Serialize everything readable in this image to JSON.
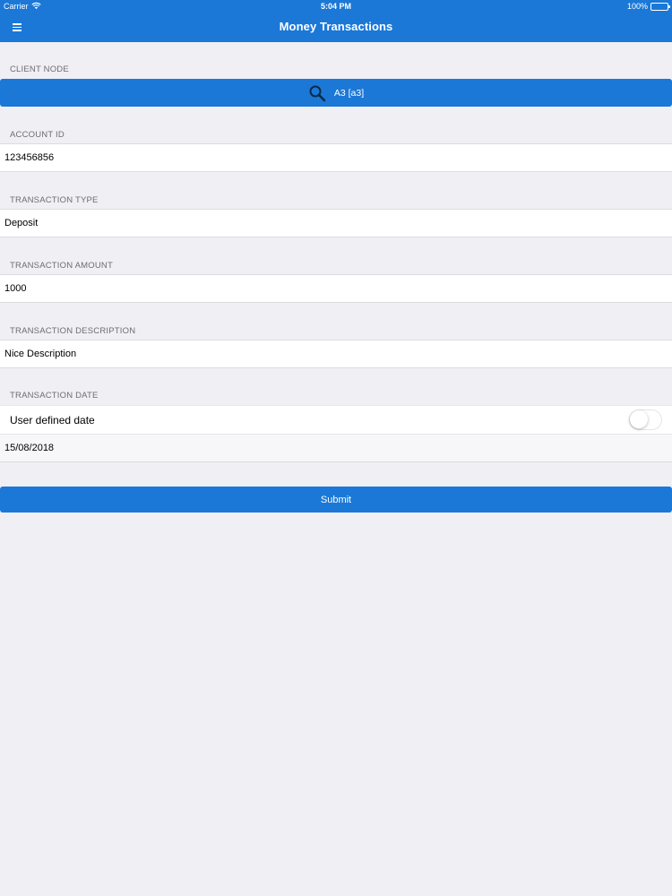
{
  "status_bar": {
    "carrier": "Carrier",
    "time": "5:04 PM",
    "battery": "100%"
  },
  "nav": {
    "title": "Money Transactions",
    "icon_menu": "hamburger-menu-icon"
  },
  "client_node": {
    "label": "CLIENT NODE",
    "button_text": "A3 [a3]",
    "icon": "search-icon"
  },
  "account_id": {
    "label": "ACCOUNT ID",
    "value": "123456856"
  },
  "transaction_type": {
    "label": "TRANSACTION TYPE",
    "value": "Deposit"
  },
  "transaction_amount": {
    "label": "TRANSACTION AMOUNT",
    "value": "1000"
  },
  "transaction_description": {
    "label": "TRANSACTION DESCRIPTION",
    "value": "Nice Description"
  },
  "transaction_date": {
    "label": "TRANSACTION DATE",
    "toggle_label": "User defined date",
    "toggle_on": false,
    "value": "15/08/2018"
  },
  "submit": {
    "label": "Submit"
  },
  "colors": {
    "accent": "#1b78d7",
    "background": "#efeff4"
  }
}
